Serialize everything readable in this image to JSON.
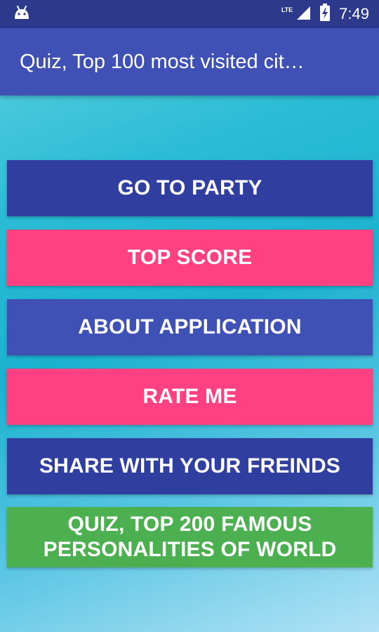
{
  "status_bar": {
    "time": "7:49",
    "network": "LTE",
    "icons": [
      "android-icon",
      "signal-icon",
      "battery-icon"
    ]
  },
  "app_bar": {
    "title": "Quiz, Top 100 most visited cit…"
  },
  "menu": {
    "go_to_party": "GO TO PARTY",
    "top_score": "TOP SCORE",
    "about_application": "ABOUT APPLICATION",
    "rate_me": "RATE ME",
    "share": "SHARE WITH YOUR FREINDS",
    "quiz_line1": "QUIZ, TOP 200 FAMOUS",
    "quiz_line2": "PERSONALITIES OF WORLD"
  },
  "colors": {
    "status_bar": "#2d3a8c",
    "app_bar": "#3f51b5",
    "navy_button": "#303f9f",
    "pink_button": "#ff4081",
    "indigo_button": "#3f51b5",
    "green_button": "#4caf50"
  }
}
